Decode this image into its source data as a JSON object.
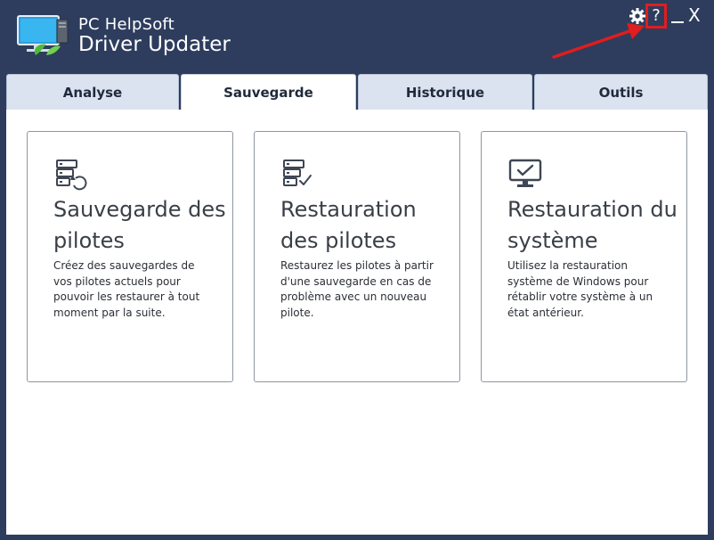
{
  "app": {
    "brand_line1": "PC HelpSoft",
    "brand_line2": "Driver Updater"
  },
  "window_controls": {
    "settings_icon": "gear-icon",
    "help_label": "?",
    "minimize_icon": "minimize-icon",
    "close_label": "X"
  },
  "annotation": {
    "highlight_color": "#e11d1d"
  },
  "tabs": [
    {
      "label": "Analyse",
      "active": false
    },
    {
      "label": "Sauvegarde",
      "active": true
    },
    {
      "label": "Historique",
      "active": false
    },
    {
      "label": "Outils",
      "active": false
    }
  ],
  "cards": [
    {
      "icon": "backup-server-icon",
      "title": "Sauvegarde des pilotes",
      "description": "Créez des sauvegardes de vos pilotes actuels pour pouvoir les restaurer à tout moment par la suite."
    },
    {
      "icon": "restore-server-icon",
      "title": "Restauration des pilotes",
      "description": "Restaurez les pilotes à partir d'une sauvegarde en cas de problème avec un nouveau pilote."
    },
    {
      "icon": "monitor-check-icon",
      "title": "Restauration du système",
      "description": "Utilisez la restauration système de Windows pour rétablir votre système à un état antérieur."
    }
  ],
  "colors": {
    "window_bg": "#2e3d5d",
    "tab_bg": "#dbe3f0",
    "content_bg": "#ffffff",
    "card_border": "#8f96a0"
  }
}
